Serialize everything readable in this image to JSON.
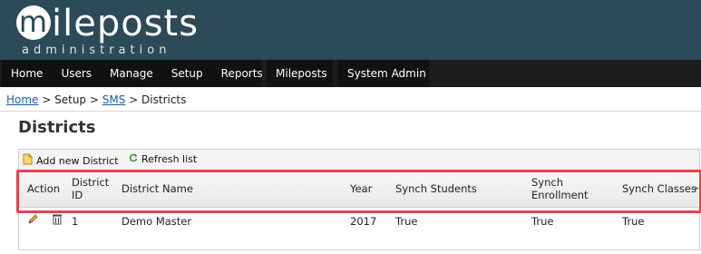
{
  "app": {
    "logo_main_letter": "m",
    "logo_main_rest": "ileposts",
    "logo_sub": "administration"
  },
  "nav": {
    "group1": [
      "Home",
      "Users",
      "Manage",
      "Setup",
      "Reports"
    ],
    "group2": [
      "Mileposts"
    ],
    "group3": [
      "System Admin"
    ]
  },
  "breadcrumb": {
    "home": "Home",
    "sep1": " > ",
    "setup": "Setup",
    "sep2": " > ",
    "sms": "SMS",
    "sep3": " > ",
    "current": "Districts"
  },
  "page": {
    "title": "Districts"
  },
  "toolbar": {
    "add_label": "Add new District",
    "refresh_label": "Refresh list"
  },
  "table": {
    "headers": {
      "action": "Action",
      "district_id_line1": "District",
      "district_id_line2": "ID",
      "district_name": "District Name",
      "year": "Year",
      "synch_students": "Synch Students",
      "synch_enrollment_line1": "Synch",
      "synch_enrollment_line2": "Enrollment",
      "synch_classes": "Synch Classes"
    },
    "rows": [
      {
        "district_id": "1",
        "district_name": "Demo Master",
        "year": "2017",
        "synch_students": "True",
        "synch_enrollment": "True",
        "synch_classes": "True"
      }
    ]
  },
  "colors": {
    "header_bg": "#2c4a57",
    "nav_bg": "#1c1c1c",
    "link": "#1a5e9e",
    "highlight": "#e8414f"
  }
}
